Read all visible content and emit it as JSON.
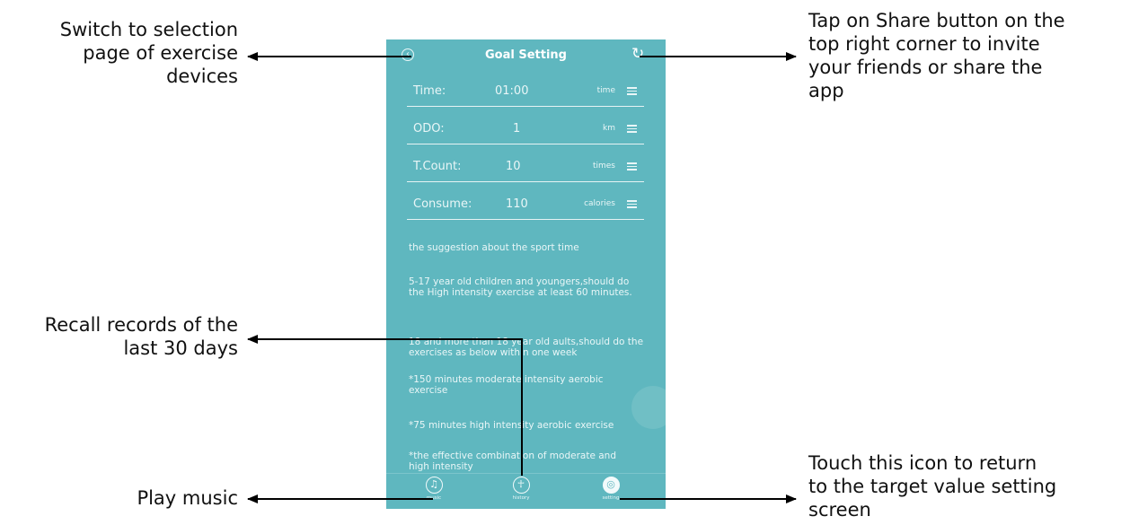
{
  "annotations": {
    "back": [
      "Switch to selection",
      "page of exercise",
      "devices"
    ],
    "share": [
      "Tap on Share button on the",
      "top right corner to invite",
      "your friends or share the",
      "app"
    ],
    "history": [
      "Recall records of the",
      "last 30 days"
    ],
    "music": [
      "Play music"
    ],
    "setting": [
      "Touch this icon to return",
      "to the target value setting",
      "screen"
    ]
  },
  "phone": {
    "title": "Goal Setting",
    "rows": [
      {
        "label": "Time:",
        "value": "01:00",
        "unit": "time"
      },
      {
        "label": "ODO:",
        "value": "1",
        "unit": "km"
      },
      {
        "label": "T.Count:",
        "value": "10",
        "unit": "times"
      },
      {
        "label": "Consume:",
        "value": "110",
        "unit": "calories"
      }
    ],
    "suggestion_title": "the suggestion about the sport time",
    "paragraphs": [
      "5-17 year old children and youngers,should do the High intensity exercise at least 60 minutes.",
      "18 and more than 18 year old aults,should do the exercises as below within one week",
      "*150 minutes moderate intensity aerobic exercise",
      "*75 minutes high intensity aerobic exercise",
      "*the effective combination of moderate and high intensity"
    ],
    "tabs": [
      {
        "label": "music",
        "icon": "music-note-icon",
        "glyph": "♫"
      },
      {
        "label": "history",
        "icon": "runner-icon",
        "glyph": "🏃"
      },
      {
        "label": "setting",
        "icon": "settings-icon",
        "glyph": "◎"
      }
    ]
  }
}
